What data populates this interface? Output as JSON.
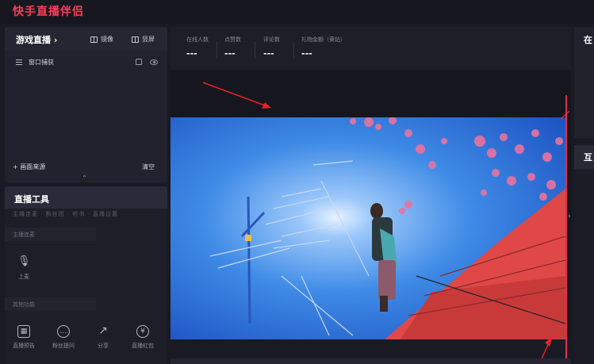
{
  "app": {
    "title": "快手直播伴侣"
  },
  "scene": {
    "title": "游戏直播 ›",
    "mirror_label": "镜像",
    "portrait_label": "竖屏",
    "source_label": "窗口捕获",
    "add_source_label": "+ 画面来源",
    "clear_label": "清空"
  },
  "tools": {
    "title": "直播工具",
    "hidden_row": "主播连麦 · 粉丝团 · 听书 · 直播设置",
    "section_1": "主播连麦",
    "mic_label": "上麦",
    "section_2": "其他功能",
    "items": [
      {
        "label": "直播预告",
        "icon": "calendar-icon",
        "glyph": "▦"
      },
      {
        "label": "粉丝提问",
        "icon": "chat-icon",
        "glyph": "…"
      },
      {
        "label": "分享",
        "icon": "share-icon",
        "glyph": "↗"
      },
      {
        "label": "直播红包",
        "icon": "redpacket-icon",
        "glyph": "¥"
      }
    ]
  },
  "stats": {
    "online_label": "在线人数",
    "online_value": "---",
    "likes_label": "点赞数",
    "likes_value": "---",
    "comments_label": "评论数",
    "comments_value": "---",
    "gifts_label": "礼物金额（黄钻）",
    "gifts_value": "---"
  },
  "right_panel": {
    "title_1": "在",
    "title_2": "互"
  },
  "colors": {
    "brand": "#ff3d5a",
    "background": "#1a1a24",
    "annotation": "#e8222a"
  }
}
